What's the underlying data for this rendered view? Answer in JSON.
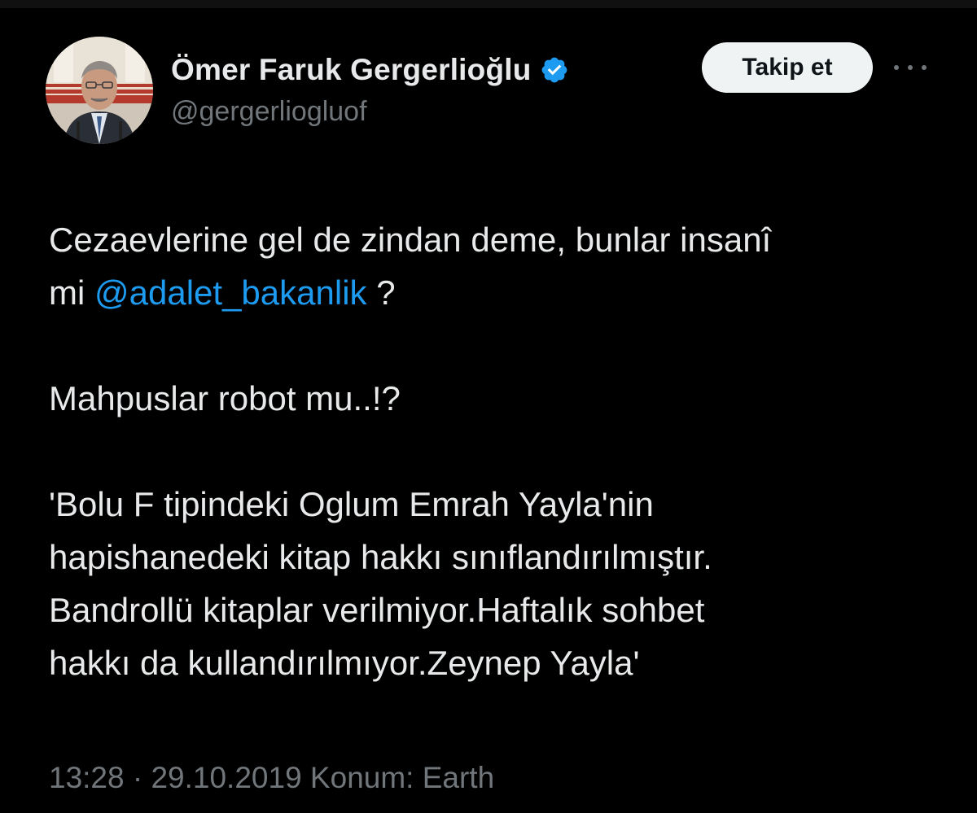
{
  "user": {
    "display_name": "Ömer Faruk Gergerlioğlu",
    "handle": "@gergerliogluof",
    "verified_icon": "verified-badge-icon",
    "verified_color": "#1d9bf0"
  },
  "actions": {
    "follow_label": "Takip et",
    "more_icon": "more-options-icon"
  },
  "tweet": {
    "line1": "Cezaevlerine gel de zindan deme, bunlar insanî",
    "line2_prefix": "mi ",
    "mention": "@adalet_bakanlik",
    "line2_suffix": " ?",
    "line3": "Mahpuslar robot mu..!?",
    "line4": "'Bolu F tipindeki Oglum Emrah Yayla'nin",
    "line5": "hapishanedeki  kitap hakkı sınıflandırılmıştır.",
    "line6": "Bandrollü kitaplar verilmiyor.Haftalık sohbet",
    "line7": "hakkı da kullandırılmıyor.Zeynep Yayla'"
  },
  "meta": {
    "text": "13:28 · 29.10.2019 Konum: Earth"
  },
  "colors": {
    "background": "#000000",
    "text": "#e7e9ea",
    "secondary": "#71767b",
    "link": "#1d9bf0",
    "button_bg": "#eff3f4"
  }
}
